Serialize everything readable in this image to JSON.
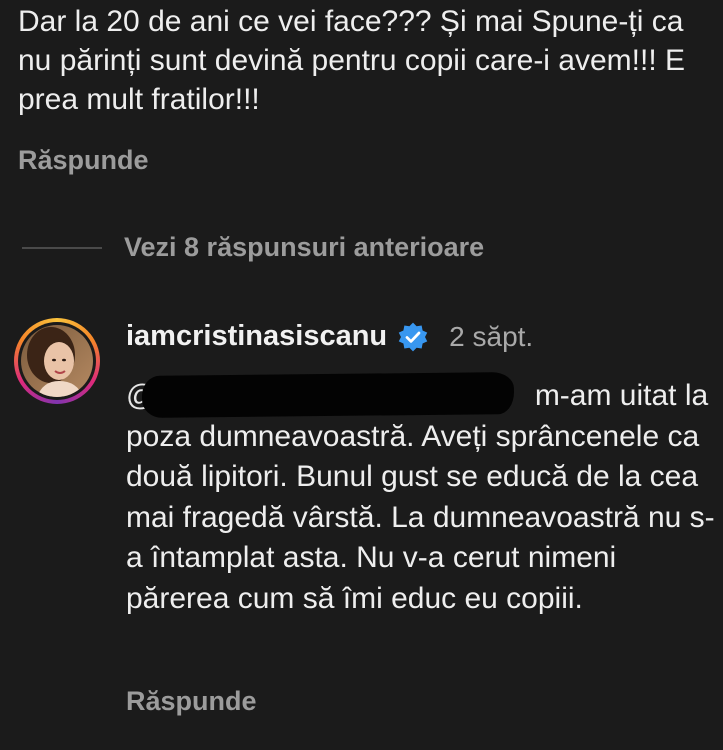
{
  "previous_comment": {
    "text": "Dar la 20 de ani ce vei face??? Și mai Spune-ți ca nu părinți sunt devină pentru copii care-i avem!!! E prea mult fratilor!!!",
    "reply_label": "Răspunde"
  },
  "view_replies": {
    "label": "Vezi 8 răspunsuri anterioare"
  },
  "comment": {
    "username": "iamcristinasiscanu",
    "time": "2 săpt.",
    "mention_prefix": "@",
    "body": "m-am uitat la poza dumneavoastră. Aveți sprâncenele ca două lipitori. Bunul gust se educă de la cea mai fragedă vârstă. La dumneavoastră nu s-a întamplat asta. Nu v-a cerut nimeni părerea cum să îmi educ eu copiii.",
    "reply_label": "Răspunde",
    "verified_color": "#3897f0"
  },
  "colors": {
    "background": "#1b1b1b",
    "text": "#eeeeee",
    "muted": "#9c9c9c"
  },
  "icons": {
    "verified": "verified-badge-icon",
    "avatar": "profile-avatar"
  }
}
